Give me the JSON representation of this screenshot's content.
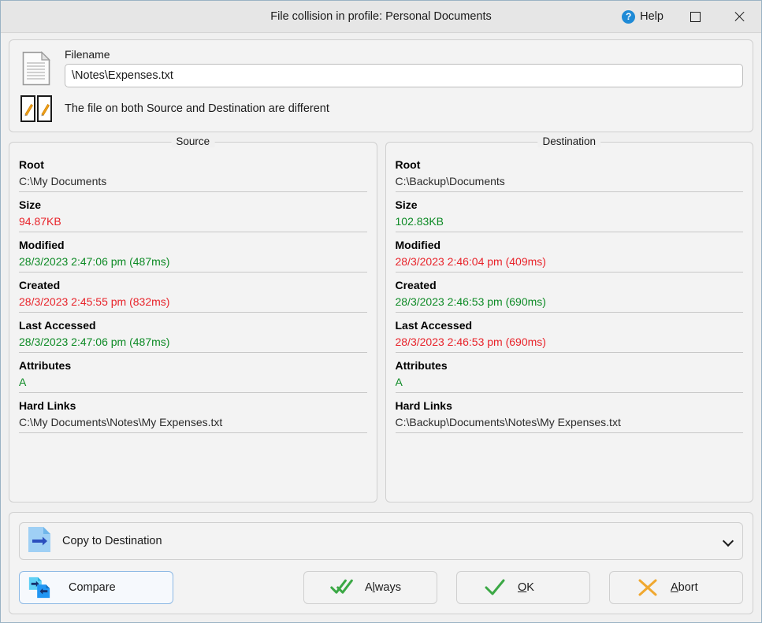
{
  "window": {
    "title": "File collision in profile: Personal Documents",
    "help_label": "Help",
    "maximize_icon": "maximize-icon",
    "close_icon": "close-icon"
  },
  "header": {
    "file_icon": "document-icon",
    "filename_label": "Filename",
    "filename_value": "\\Notes\\Expenses.txt",
    "filename_placeholder": "Filename",
    "diff_icon": "two-files-modified-icon",
    "status_text": "The file on both Source and Destination are different"
  },
  "panels": [
    {
      "legend": "Source",
      "fields": [
        {
          "label": "Root",
          "value": "C:\\My Documents",
          "color": "neutral"
        },
        {
          "label": "Size",
          "value": "94.87KB",
          "color": "red"
        },
        {
          "label": "Modified",
          "value": "28/3/2023 2:47:06 pm (487ms)",
          "color": "green"
        },
        {
          "label": "Created",
          "value": "28/3/2023 2:45:55 pm (832ms)",
          "color": "red"
        },
        {
          "label": "Last Accessed",
          "value": "28/3/2023 2:47:06 pm (487ms)",
          "color": "green"
        },
        {
          "label": "Attributes",
          "value": "A",
          "color": "green"
        },
        {
          "label": "Hard Links",
          "value": "C:\\My Documents\\Notes\\My Expenses.txt",
          "color": "neutral"
        }
      ]
    },
    {
      "legend": "Destination",
      "fields": [
        {
          "label": "Root",
          "value": "C:\\Backup\\Documents",
          "color": "neutral"
        },
        {
          "label": "Size",
          "value": "102.83KB",
          "color": "green"
        },
        {
          "label": "Modified",
          "value": "28/3/2023 2:46:04 pm (409ms)",
          "color": "red"
        },
        {
          "label": "Created",
          "value": "28/3/2023 2:46:53 pm (690ms)",
          "color": "green"
        },
        {
          "label": "Last Accessed",
          "value": "28/3/2023 2:46:53 pm (690ms)",
          "color": "red"
        },
        {
          "label": "Attributes",
          "value": "A",
          "color": "green"
        },
        {
          "label": "Hard Links",
          "value": "C:\\Backup\\Documents\\Notes\\My Expenses.txt",
          "color": "neutral"
        }
      ]
    }
  ],
  "actions": {
    "resolution_icon": "copy-to-destination-icon",
    "resolution_value": "Copy to Destination",
    "chevron_icon": "chevron-down-icon",
    "buttons": [
      {
        "name": "compare",
        "icon": "compare-files-icon",
        "label": "Compare",
        "accel_before": "Compare",
        "accel": "",
        "accel_after": "",
        "focused": true
      },
      {
        "name": "always",
        "icon": "double-check-icon",
        "label": "Always",
        "accel_before": "A",
        "accel": "l",
        "accel_after": "ways",
        "focused": false
      },
      {
        "name": "ok",
        "icon": "check-icon",
        "label": "OK",
        "accel_before": "",
        "accel": "O",
        "accel_after": "K",
        "focused": false
      },
      {
        "name": "abort",
        "icon": "cross-icon",
        "label": "Abort",
        "accel_before": "",
        "accel": "A",
        "accel_after": "bort",
        "focused": false
      }
    ]
  },
  "colors": {
    "accent": "#1e8ad6",
    "different_red": "#e8232a",
    "same_green": "#0d8a25",
    "window_bg": "#f0f0f0"
  }
}
